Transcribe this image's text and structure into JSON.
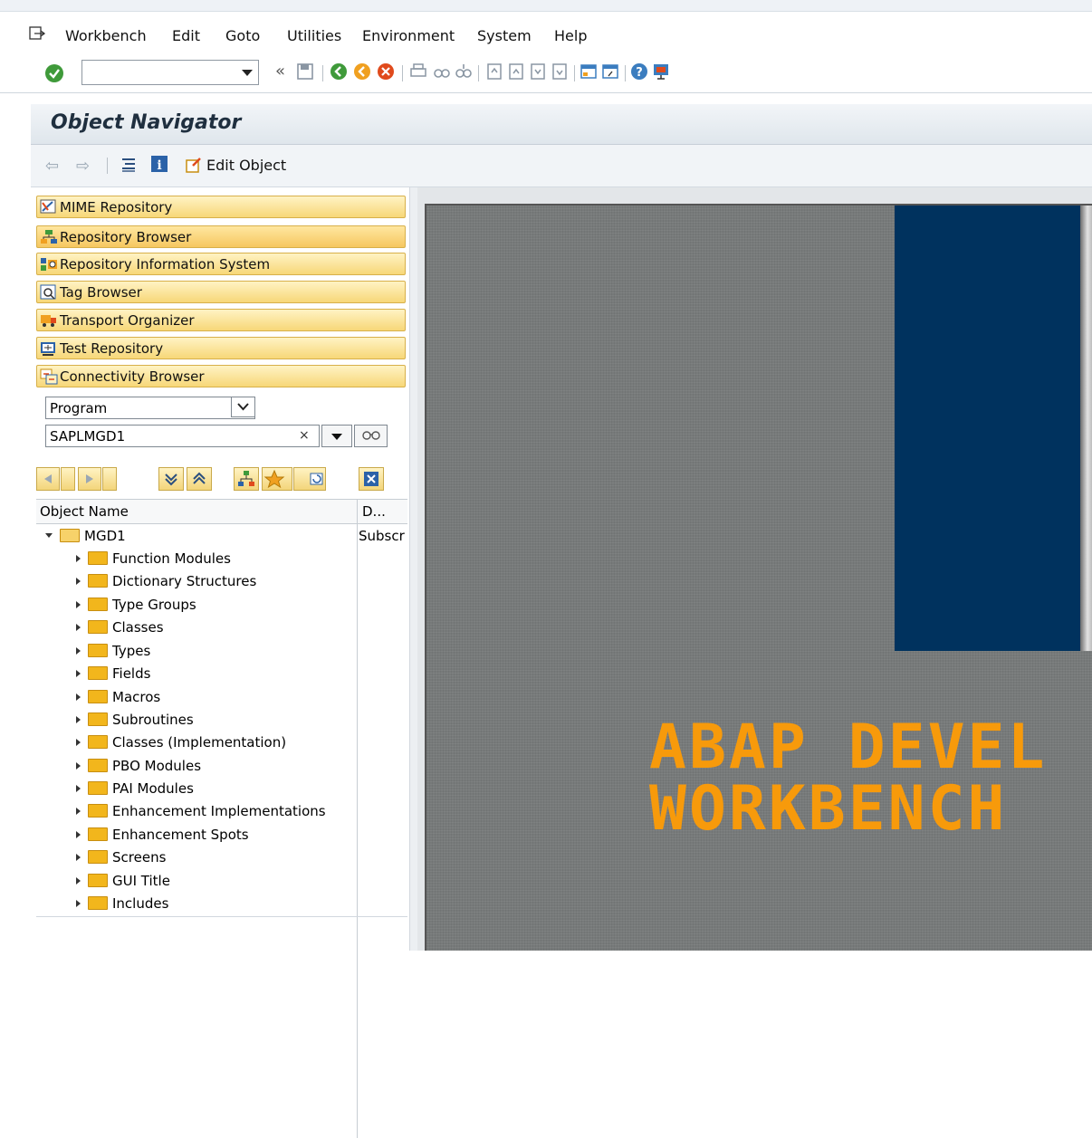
{
  "menubar": {
    "items": [
      {
        "label": "Workbench"
      },
      {
        "label": "Edit"
      },
      {
        "label": "Goto"
      },
      {
        "label": "Utilities"
      },
      {
        "label": "Environment"
      },
      {
        "label": "System"
      },
      {
        "label": "Help"
      }
    ]
  },
  "toolbar": {
    "command_field_value": "",
    "icons": [
      "check-icon",
      "back-double-icon",
      "save-icon",
      "back-icon",
      "exit-icon",
      "cancel-icon",
      "print-icon",
      "find-icon",
      "find-next-icon",
      "first-page-icon",
      "previous-page-icon",
      "next-page-icon",
      "last-page-icon",
      "new-session-icon",
      "shortcut-icon",
      "help-icon",
      "layout-icon"
    ]
  },
  "header": {
    "title": "Object Navigator"
  },
  "app_toolbar": {
    "edit_object_label": "Edit Object"
  },
  "navigator": {
    "buttons": [
      {
        "label": "MIME Repository",
        "icon": "mime-icon"
      },
      {
        "label": "Repository Browser",
        "icon": "repository-browser-icon",
        "active": true
      },
      {
        "label": "Repository Information System",
        "icon": "info-system-icon"
      },
      {
        "label": "Tag Browser",
        "icon": "tag-browser-icon"
      },
      {
        "label": "Transport Organizer",
        "icon": "transport-icon"
      },
      {
        "label": "Test Repository",
        "icon": "test-repository-icon"
      },
      {
        "label": "Connectivity Browser",
        "icon": "connectivity-icon"
      }
    ],
    "object_type_selected": "Program",
    "object_name_value": "SAPLMGD1"
  },
  "tree": {
    "columns": {
      "name": "Object Name",
      "desc": "D..."
    },
    "root": {
      "label": "MGD1",
      "desc": "Subscr"
    },
    "children": [
      {
        "label": "Function Modules"
      },
      {
        "label": "Dictionary Structures"
      },
      {
        "label": "Type Groups"
      },
      {
        "label": "Classes"
      },
      {
        "label": "Types"
      },
      {
        "label": "Fields"
      },
      {
        "label": "Macros"
      },
      {
        "label": "Subroutines"
      },
      {
        "label": "Classes (Implementation)"
      },
      {
        "label": "PBO Modules"
      },
      {
        "label": "PAI Modules"
      },
      {
        "label": "Enhancement Implementations"
      },
      {
        "label": "Enhancement Spots"
      },
      {
        "label": "Screens"
      },
      {
        "label": "GUI Title"
      },
      {
        "label": "Includes"
      }
    ]
  },
  "splash": {
    "line1": "ABAP DEVEL",
    "line2": "WORKBENCH"
  },
  "colors": {
    "accent": "#f7d778",
    "splash_blue": "#00325e",
    "splash_text": "#f79a0b"
  }
}
